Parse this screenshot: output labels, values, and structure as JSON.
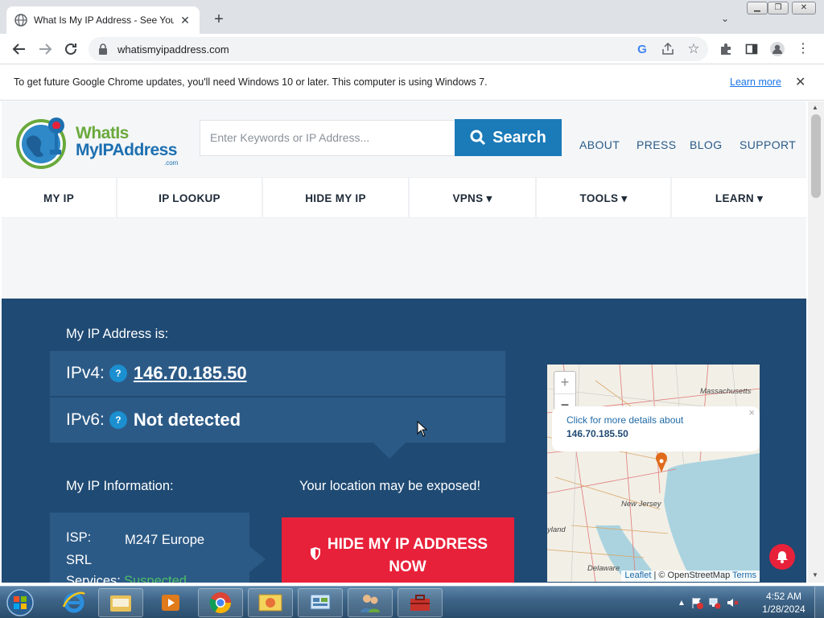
{
  "browser": {
    "tab_title": "What Is My IP Address - See Your",
    "url": "whatismyipaddress.com",
    "infobar_message": "To get future Google Chrome updates, you'll need Windows 10 or later. This computer is using Windows 7.",
    "infobar_link": "Learn more"
  },
  "site": {
    "logo_line1": "WhatIs",
    "logo_line2": "MyIPAddress",
    "logo_suffix": ".com",
    "search_placeholder": "Enter Keywords or IP Address...",
    "search_button": "Search",
    "top_links": [
      "ABOUT",
      "PRESS",
      "BLOG",
      "SUPPORT"
    ],
    "nav": [
      "MY IP",
      "IP LOOKUP",
      "HIDE MY IP",
      "VPNS ▾",
      "TOOLS ▾",
      "LEARN ▾"
    ]
  },
  "hero": {
    "ip_heading": "My IP Address is:",
    "ipv4_label": "IPv4:",
    "ipv4_value": "146.70.185.50",
    "ipv6_label": "IPv6:",
    "ipv6_value": "Not detected",
    "help_glyph": "?",
    "info_heading": "My IP Information:",
    "isp_label": "ISP:",
    "isp_value": "M247 Europe SRL",
    "services_label": "Services:",
    "services_value": "Suspected",
    "exposed_text": "Your location may be exposed!",
    "hide_button": "HIDE MY IP ADDRESS NOW"
  },
  "map": {
    "zoom_in": "+",
    "zoom_out": "−",
    "popup_line1": "Click for more details about",
    "popup_ip": "146.70.185.50",
    "label_massachusetts": "Massachusetts",
    "label_new_jersey": "New Jersey",
    "label_maryland": "yland",
    "label_delaware": "Delaware",
    "attribution_leaflet": "Leaflet",
    "attribution_sep": "| ©",
    "attribution_osm": "OpenStreetMap",
    "attribution_terms": "Terms"
  },
  "taskbar": {
    "time": "4:52 AM",
    "date": "1/28/2024"
  },
  "colors": {
    "hero_bg": "#1f4a73",
    "card_bg": "#2c5a86",
    "accent_blue": "#1b7ab8",
    "hide_red": "#e8213a",
    "suspected_green": "#4cc067"
  }
}
